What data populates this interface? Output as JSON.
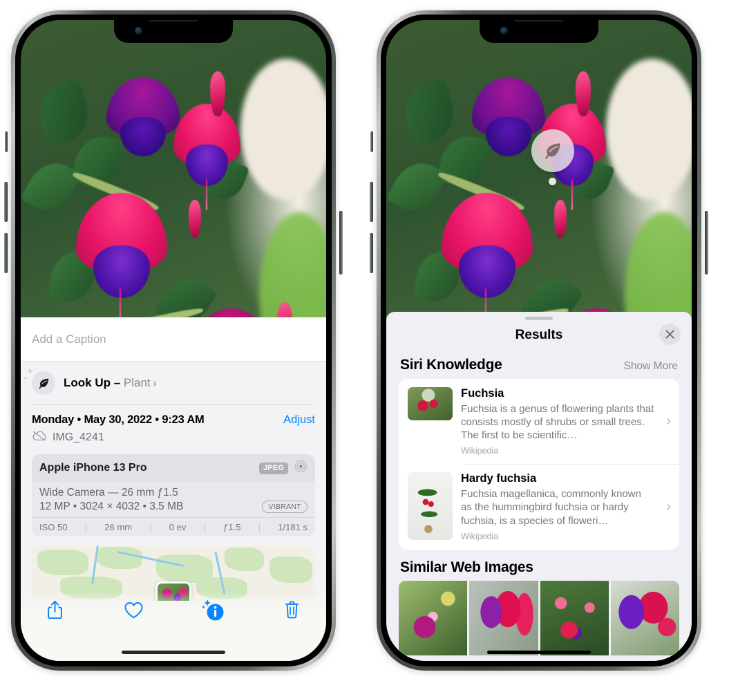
{
  "left_phone": {
    "name": "iPhone Photos info view",
    "photo_alt": "fuchsia-flowers-photo",
    "caption": {
      "placeholder": "Add a Caption",
      "value": ""
    },
    "lookup": {
      "icon": "leaf-icon",
      "sparkle_icon": "sparkles-icon",
      "label": "Look Up",
      "separator": "–",
      "subject": "Plant",
      "chevron": "›"
    },
    "metadata": {
      "date": "Monday • May 30, 2022 • 9:23 AM",
      "adjust_label": "Adjust",
      "cloud_icon": "icloud-slash-icon",
      "filename": "IMG_4241"
    },
    "camera_card": {
      "device": "Apple iPhone 13 Pro",
      "format_badge": "JPEG",
      "aperture_icon": "camera-aperture-icon",
      "lens_line": "Wide Camera — 26 mm ƒ1.5",
      "specs_line": "12 MP • 3024 × 4032 • 3.5 MB",
      "style_badge": "VIBRANT",
      "exif": [
        "ISO 50",
        "26 mm",
        "0 ev",
        "ƒ1.5",
        "1/181 s"
      ],
      "exif_separator": "|"
    },
    "map": {
      "name": "location-map-thumbnail",
      "pin": "photo-pin"
    },
    "toolbar": [
      {
        "name": "share-button",
        "icon": "share-icon"
      },
      {
        "name": "favorite-button",
        "icon": "heart-icon"
      },
      {
        "name": "info-button",
        "icon": "info-sparkles-icon",
        "active": true
      },
      {
        "name": "delete-button",
        "icon": "trash-icon"
      }
    ]
  },
  "right_phone": {
    "name": "Visual Look Up results view",
    "visual_lookup_badge": {
      "icon": "leaf-icon",
      "indicator": "subject-dot"
    },
    "sheet": {
      "grabber": "drag-handle",
      "title": "Results",
      "close_icon": "close-icon"
    },
    "siri_knowledge": {
      "section_title": "Siri Knowledge",
      "show_more": "Show More",
      "items": [
        {
          "thumb": "fuchsia-thumbnail",
          "title": "Fuchsia",
          "description": "Fuchsia is a genus of flowering plants that consists mostly of shrubs or small trees. The first to be scientific…",
          "source": "Wikipedia",
          "chevron": "›"
        },
        {
          "thumb": "hardy-fuchsia-thumbnail",
          "title": "Hardy fuchsia",
          "description": "Fuchsia magellanica, commonly known as the hummingbird fuchsia or hardy fuchsia, is a species of floweri…",
          "source": "Wikipedia",
          "chevron": "›"
        }
      ]
    },
    "similar_web_images": {
      "section_title": "Similar Web Images",
      "thumbnails": [
        "web-image-1-pink-fuchsia",
        "web-image-2-red-fuchsia",
        "web-image-3-fuchsia-bush",
        "web-image-4-purple-fuchsia"
      ]
    }
  },
  "colors": {
    "accent_blue": "#0a84ff",
    "sheet_bg_left": "#f3f3f6",
    "sheet_bg_right": "#f0eff5",
    "card_bg": "#ffffff",
    "secondary_text": "#8a8a90",
    "badge_grey": "#aeaeb4"
  }
}
